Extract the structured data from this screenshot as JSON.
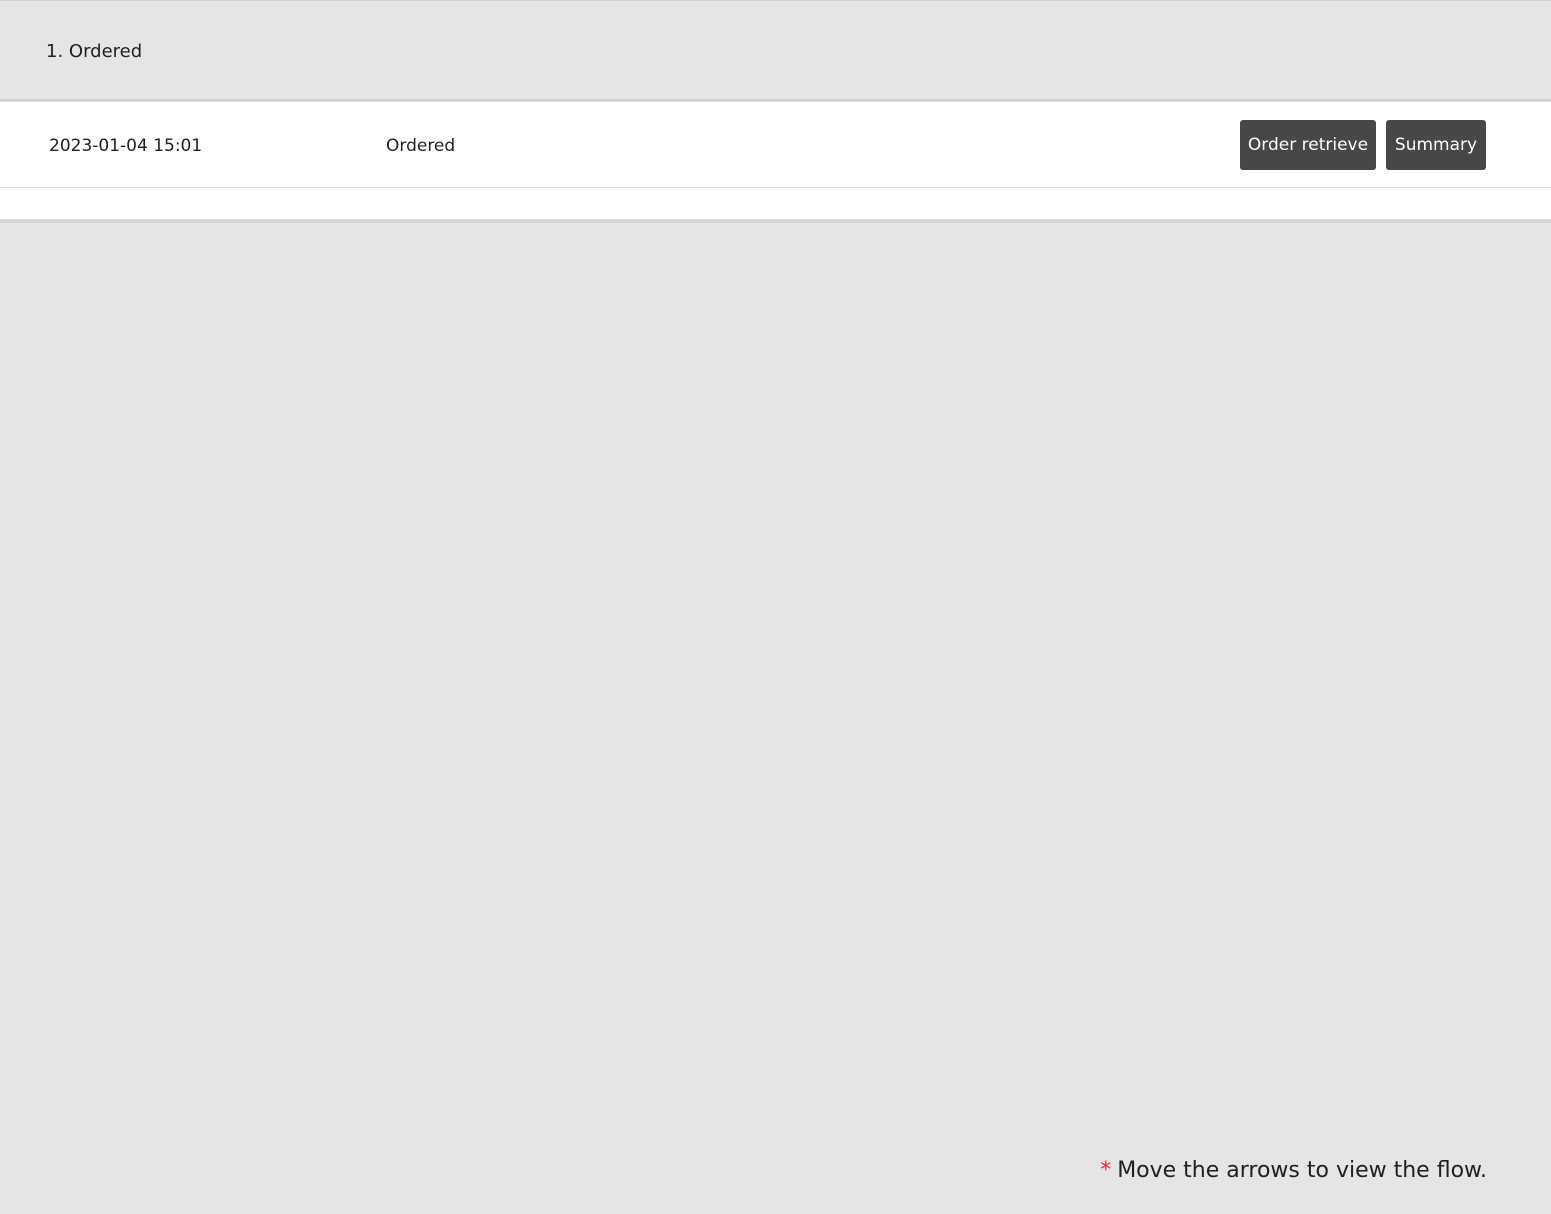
{
  "section": {
    "title": "1. Ordered"
  },
  "rows": [
    {
      "date": "2023-01-04 15:01",
      "status": "Ordered",
      "buttons": {
        "order_retrieve": "Order retrieve",
        "summary": "Summary"
      }
    }
  ],
  "footnote": {
    "asterisk": "*",
    "text": "Move the arrows to view the flow."
  },
  "colors": {
    "background": "#e5e5e5",
    "panel": "#ffffff",
    "button": "#474747",
    "button_text": "#ffffff",
    "asterisk": "#e03030"
  }
}
